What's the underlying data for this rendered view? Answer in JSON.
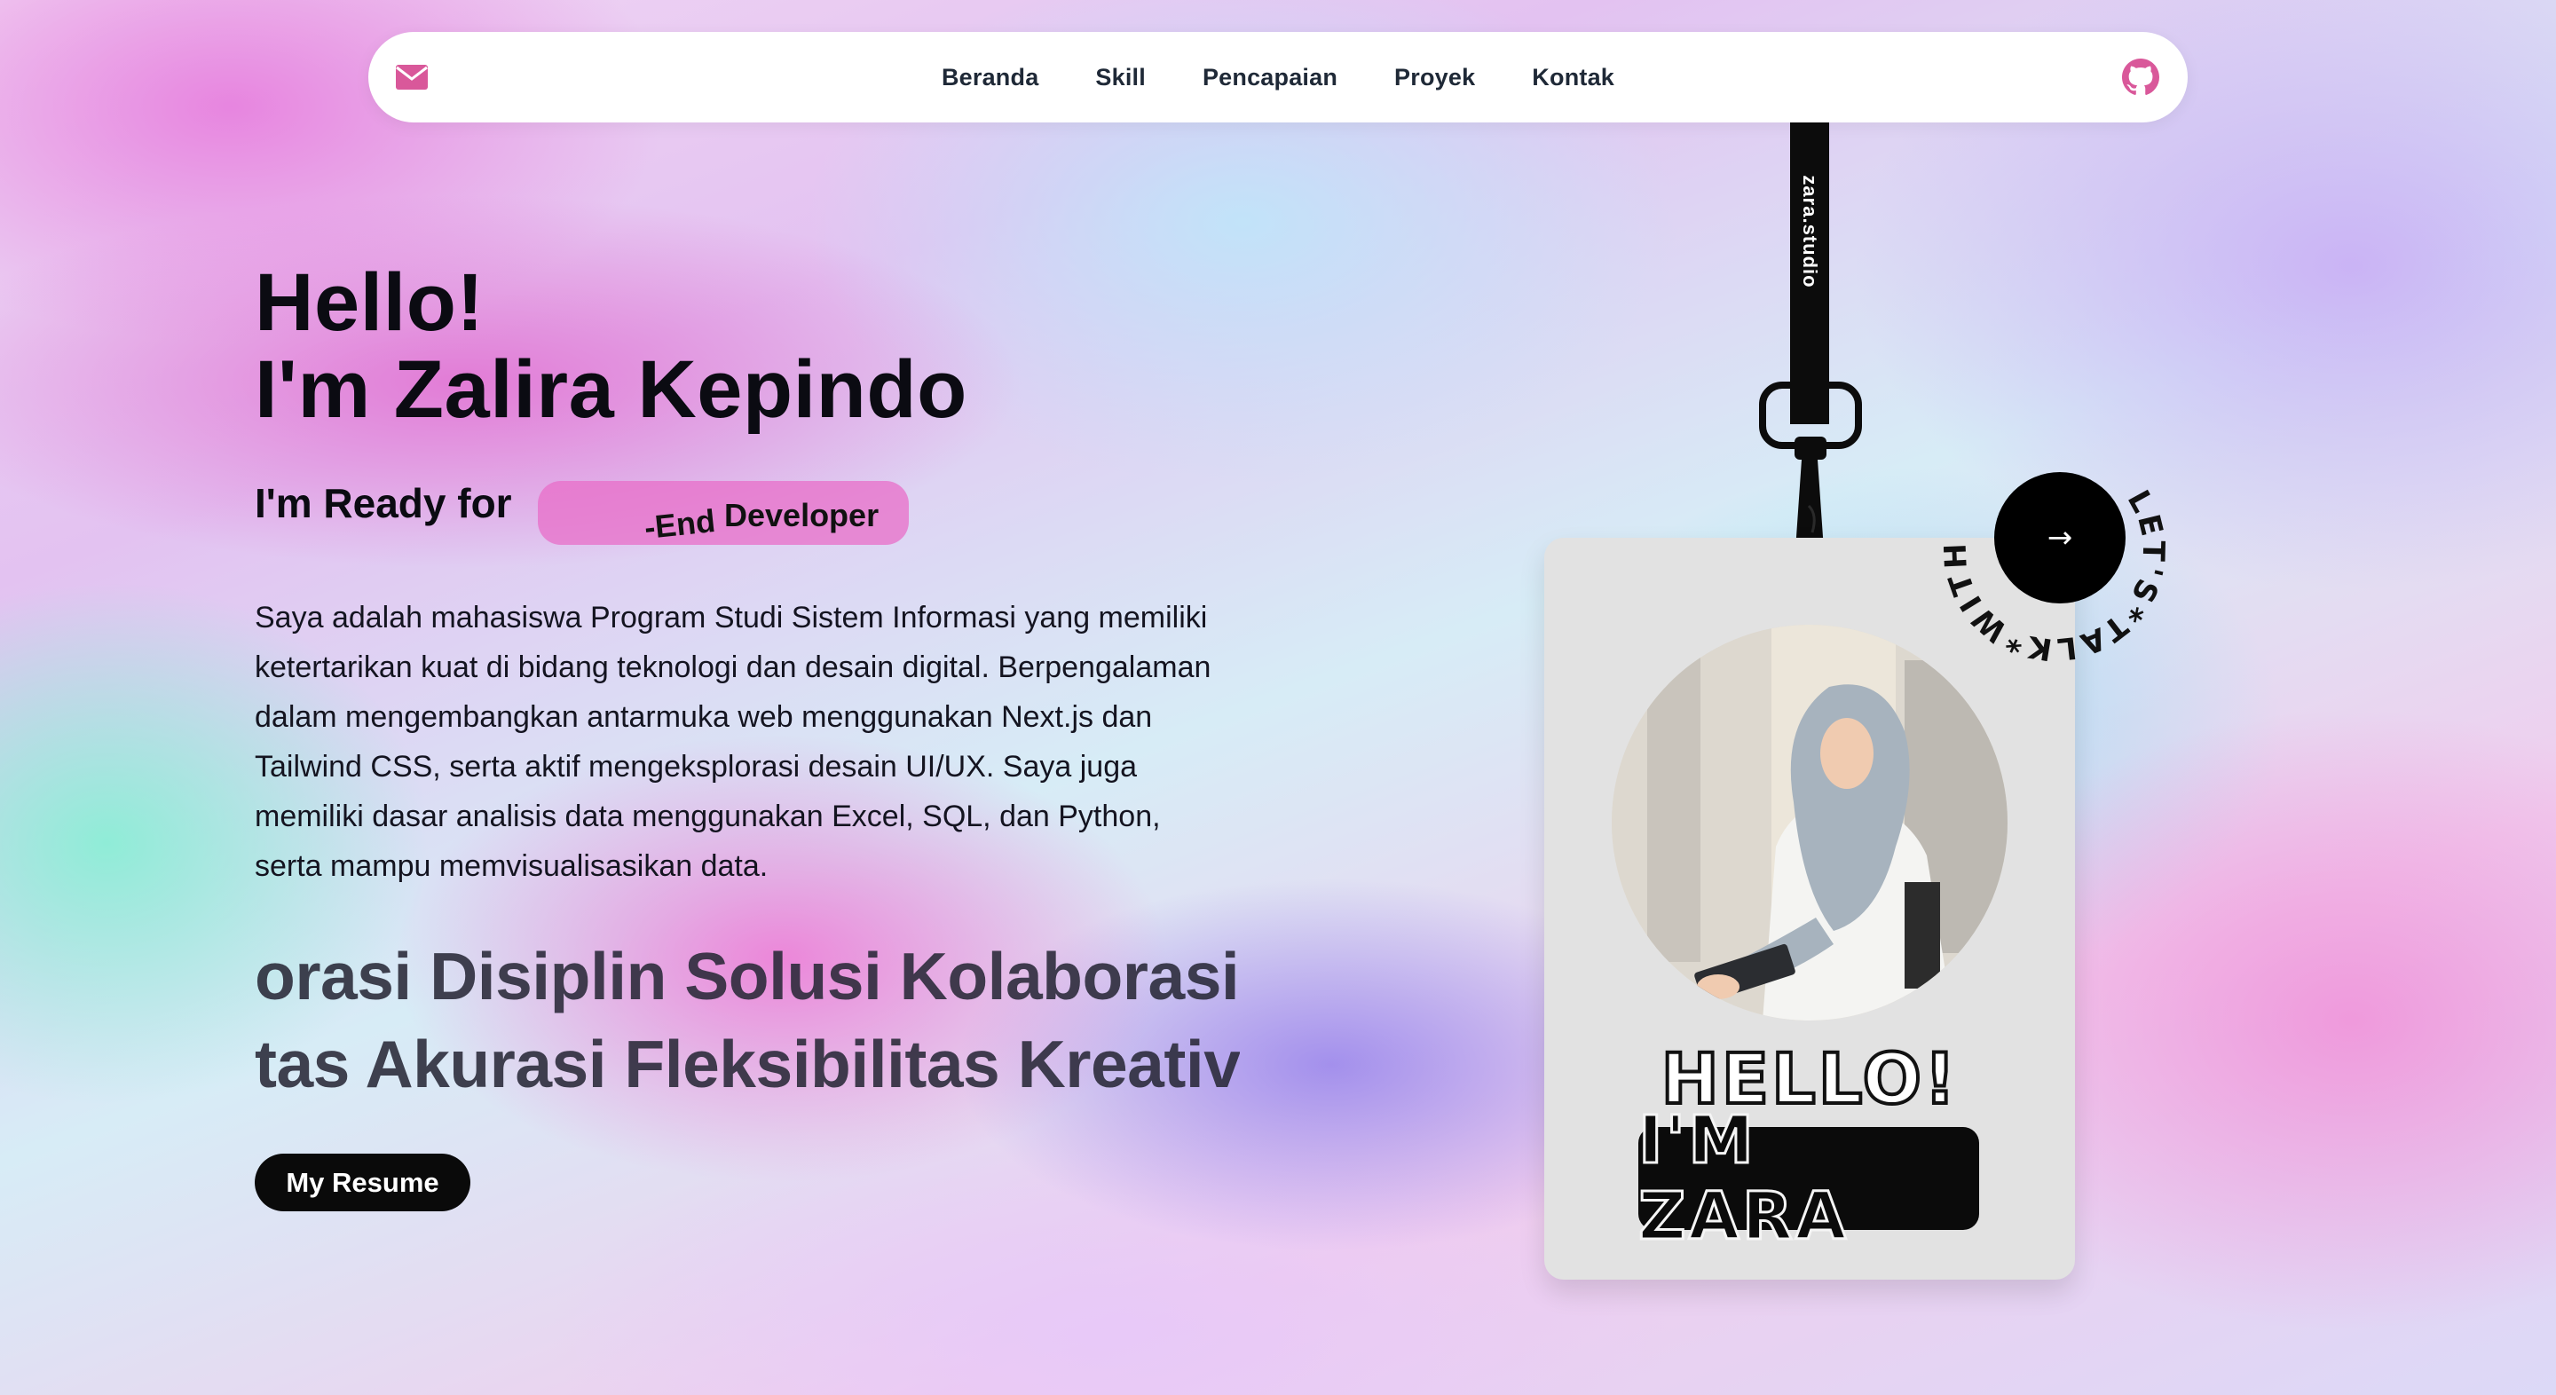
{
  "nav": {
    "items": [
      "Beranda",
      "Skill",
      "Pencapaian",
      "Proyek",
      "Kontak"
    ],
    "mail_icon": "envelope-icon",
    "github_icon": "github-icon",
    "accent_color": "#d9589a"
  },
  "hero": {
    "greeting": "Hello!",
    "name_line": "I'm Zalira Kepindo",
    "ready_label": "I'm Ready for",
    "role_partial_fragment": "-End",
    "role_text": "Developer",
    "description": "Saya adalah mahasiswa Program Studi Sistem Informasi yang memiliki ketertarikan kuat di bidang teknologi dan desain digital. Berpengalaman dalam mengembangkan antarmuka web menggunakan Next.js dan Tailwind CSS, serta aktif mengeksplorasi desain UI/UX. Saya juga memiliki dasar analisis data menggunakan Excel, SQL, dan Python, serta mampu memvisualisasikan data.",
    "marquee_1": "orasi Disiplin Solusi Kolaborasi",
    "marquee_2": "tas Akurasi Fleksibilitas Kreativi",
    "resume_button": "My Resume"
  },
  "lanyard": {
    "strap_text": "zara.studio"
  },
  "id_card": {
    "hello": "HELLO!",
    "name": "I'M ZARA"
  },
  "talk_badge": {
    "ring_text": "LET'S*TALK*WITH*ME*",
    "arrow": "→"
  }
}
